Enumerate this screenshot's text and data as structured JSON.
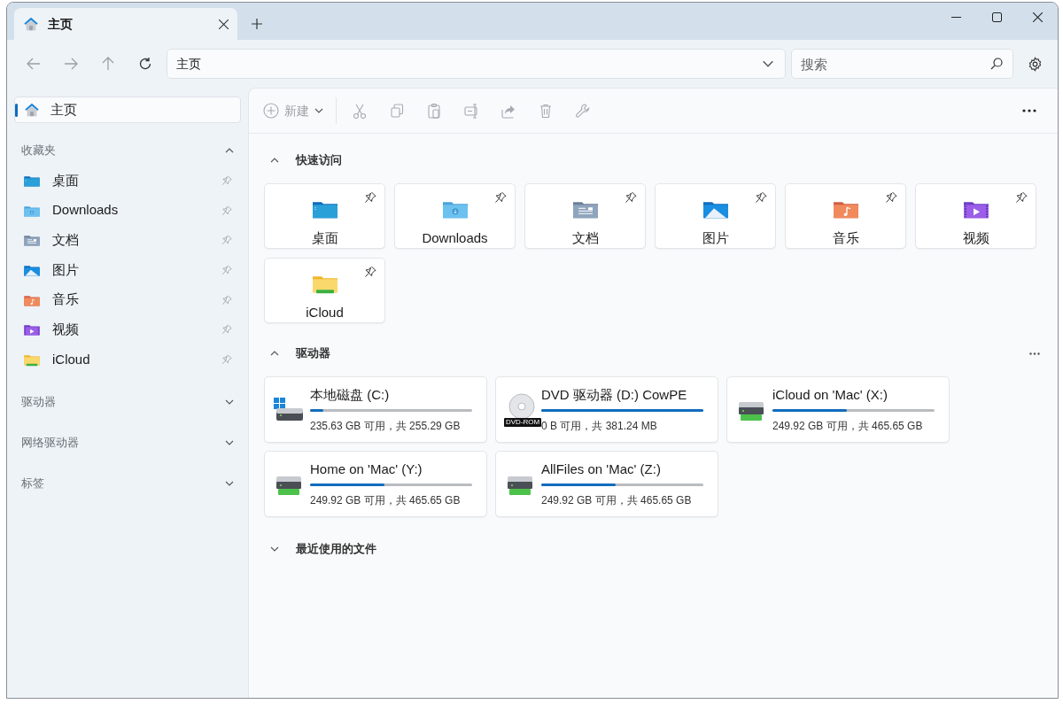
{
  "tabs": [
    {
      "title": "主页",
      "selected": true
    }
  ],
  "address": {
    "path": "主页"
  },
  "search": {
    "placeholder": "搜索"
  },
  "command_bar": {
    "new_label": "新建"
  },
  "sidebar": {
    "home": {
      "label": "主页",
      "selected": true
    },
    "sections": [
      {
        "title": "收藏夹",
        "expanded": true,
        "items": [
          {
            "label": "桌面",
            "kind": "desktop",
            "selected": false
          },
          {
            "label": "Downloads",
            "kind": "downloads",
            "selected": false
          },
          {
            "label": "文档",
            "kind": "documents",
            "selected": false
          },
          {
            "label": "图片",
            "kind": "pictures",
            "selected": false
          },
          {
            "label": "音乐",
            "kind": "music",
            "selected": false
          },
          {
            "label": "视频",
            "kind": "videos",
            "selected": false
          },
          {
            "label": "iCloud",
            "kind": "icloud",
            "selected": false
          }
        ]
      },
      {
        "title": "驱动器",
        "expanded": false
      },
      {
        "title": "网络驱动器",
        "expanded": false
      },
      {
        "title": "标签",
        "expanded": false
      }
    ]
  },
  "quick_access": {
    "title": "快速访问",
    "expanded": true,
    "items": [
      {
        "label": "桌面",
        "kind": "desktop"
      },
      {
        "label": "Downloads",
        "kind": "downloads"
      },
      {
        "label": "文档",
        "kind": "documents"
      },
      {
        "label": "图片",
        "kind": "pictures"
      },
      {
        "label": "音乐",
        "kind": "music"
      },
      {
        "label": "视频",
        "kind": "videos"
      },
      {
        "label": "iCloud",
        "kind": "icloud"
      }
    ]
  },
  "drives": {
    "title": "驱动器",
    "expanded": true,
    "items": [
      {
        "name": "本地磁盘 (C:)",
        "kind": "windows",
        "level": 0.08,
        "space": "235.63 GB 可用，共 255.29 GB"
      },
      {
        "name": "DVD 驱动器 (D:) CowPE",
        "kind": "dvd",
        "icon_label": "DVD-ROM",
        "level": 1,
        "space": "0 B 可用，共 381.24 MB"
      },
      {
        "name": "iCloud on 'Mac' (X:)",
        "kind": "network",
        "level": 0.46,
        "space": "249.92 GB 可用，共 465.65 GB"
      },
      {
        "name": "Home on 'Mac' (Y:)",
        "kind": "network",
        "level": 0.46,
        "space": "249.92 GB 可用，共 465.65 GB"
      },
      {
        "name": "AllFiles on 'Mac' (Z:)",
        "kind": "network",
        "level": 0.46,
        "space": "249.92 GB 可用，共 465.65 GB"
      }
    ]
  },
  "recent": {
    "title": "最近使用的文件",
    "expanded": false
  }
}
